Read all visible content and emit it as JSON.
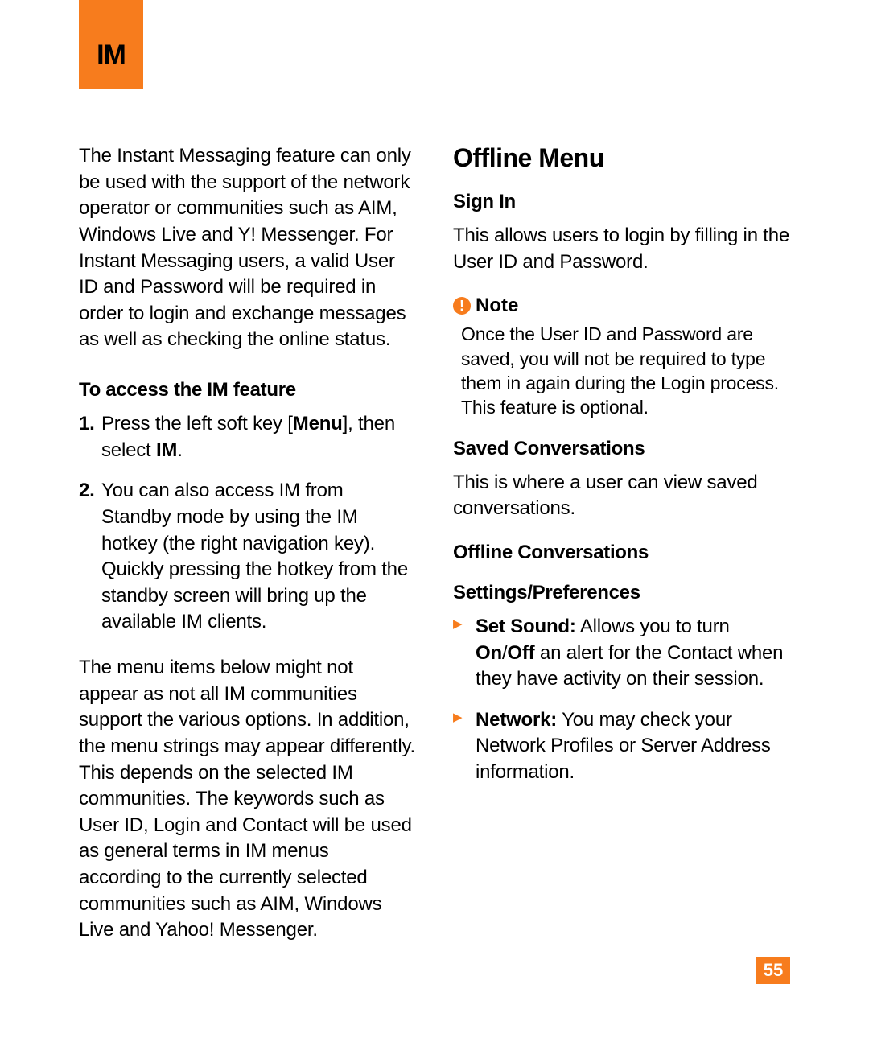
{
  "chapter": "IM",
  "col1": {
    "intro": "The Instant Messaging feature can only be used with the support of the network operator or communities such as AIM, Windows Live and Y! Messenger. For Instant Messaging users, a valid User ID and Password will be required in order to login and exchange messages as well as checking the online status.",
    "access_hdr": "To access the IM feature",
    "step1_a": "Press the left soft key [",
    "step1_b": "Menu",
    "step1_c": "], then select ",
    "step1_d": "IM",
    "step1_e": ".",
    "step2": "You can also access IM from Standby mode by using the IM hotkey (the right navigation key). Quickly pressing the hotkey from the standby screen will bring up the available IM clients.",
    "para2": "The menu items below might not appear as not all IM communities support the various options. In addition, the menu strings may appear differently. This depends on the selected IM communities. The keywords such as User ID, Login and Contact will be used as general terms in IM menus according to the currently selected communities such as AIM, Windows Live and Yahoo! Messenger."
  },
  "col2": {
    "h2": "Offline Menu",
    "signin_hdr": "Sign In",
    "signin_body": "This allows users to login by filling in the User ID and Password.",
    "note_label": "Note",
    "note_body": "Once the User ID and Password are saved, you will not be required to type them in again during the Login process. This feature is optional.",
    "saved_hdr": "Saved Conversations",
    "saved_body": "This is where a user can view saved conversations.",
    "offline_conv_hdr": "Offline Conversations",
    "settings_hdr": "Settings/Preferences",
    "bul1_a": "Set Sound:",
    "bul1_b": " Allows you to turn ",
    "bul1_c": "On",
    "bul1_d": "/",
    "bul1_e": "Off",
    "bul1_f": " an alert for the Contact when they have activity on their session.",
    "bul2_a": "Network:",
    "bul2_b": " You may check your Network Profiles or Server Address information."
  },
  "page_number": "55"
}
